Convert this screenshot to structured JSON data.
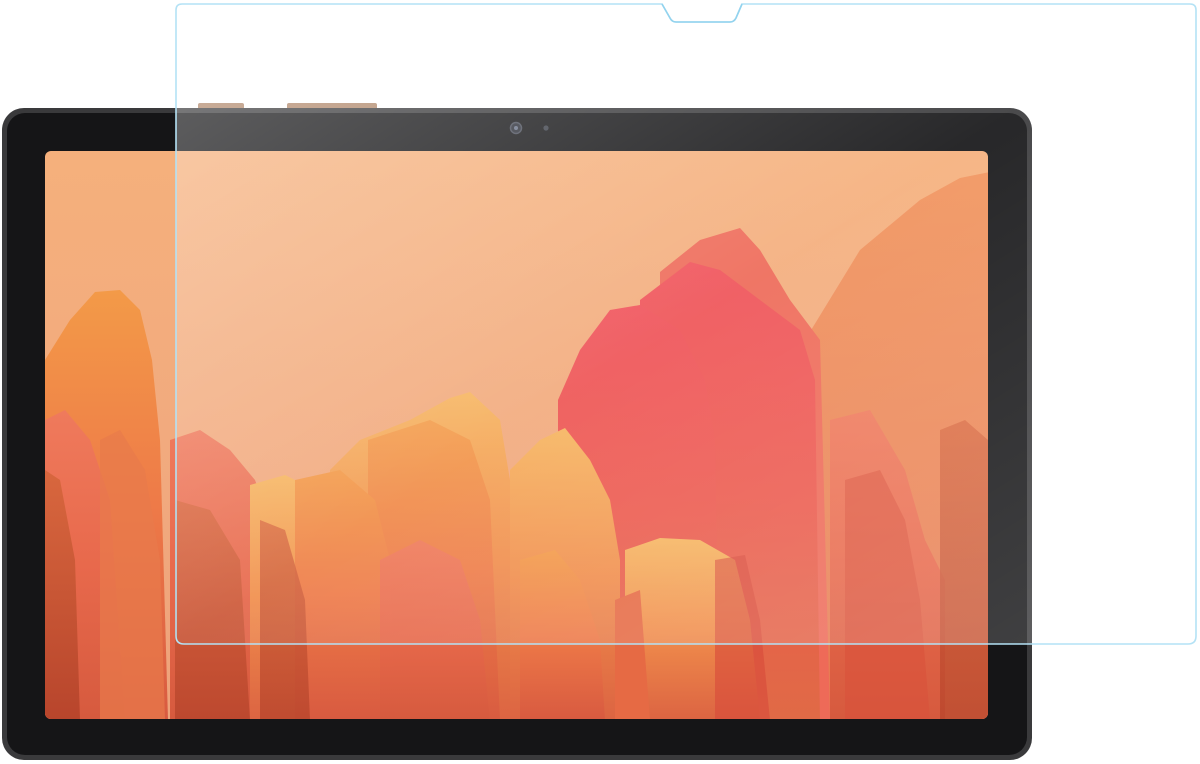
{
  "product": {
    "colors": {
      "bezel": "#1c1c1e",
      "frame": "#3a3a3c",
      "buttons": "#b0876a",
      "sky_top": "#f4ae78",
      "sky_bottom": "#f0a97e",
      "peak_warm": "#f08a3a",
      "peak_red": "#ec4c4c",
      "peak_coral": "#ea6a52",
      "protector_edge": "#a9dcf2"
    },
    "icons": [
      "front-camera-icon",
      "light-sensor-icon"
    ]
  }
}
